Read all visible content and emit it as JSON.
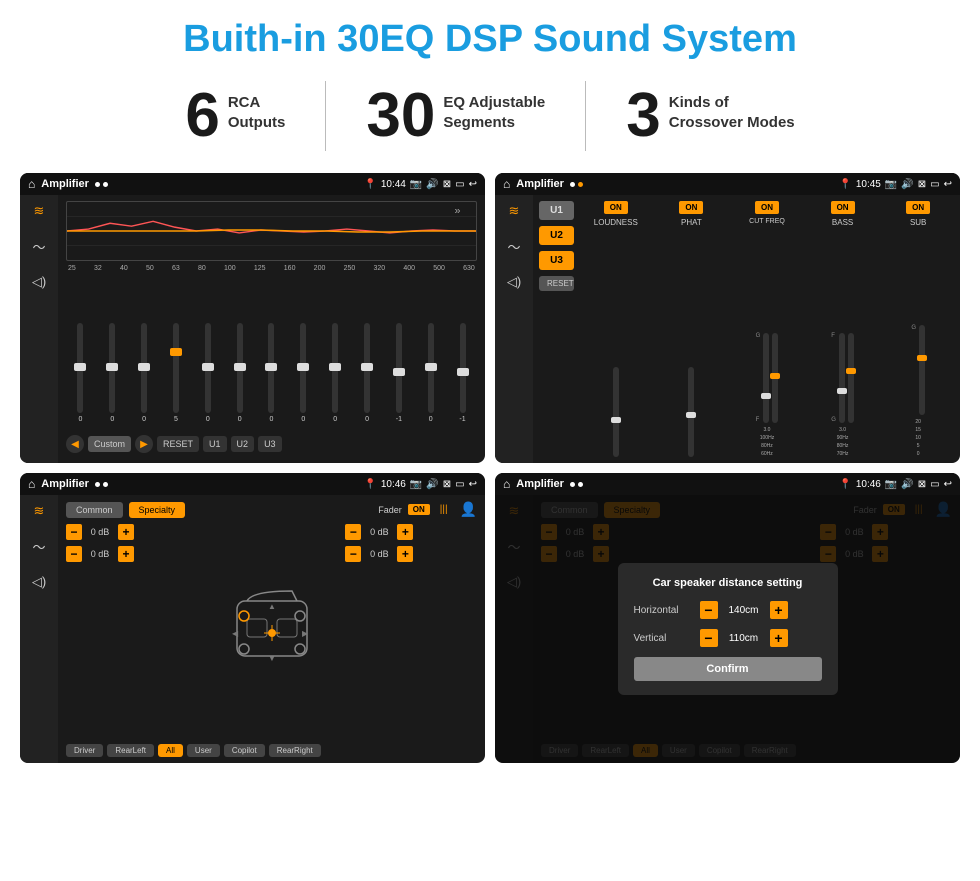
{
  "title": "Buith-in 30EQ DSP Sound System",
  "stats": [
    {
      "number": "6",
      "label": "RCA\nOutputs"
    },
    {
      "number": "30",
      "label": "EQ Adjustable\nSegments"
    },
    {
      "number": "3",
      "label": "Kinds of\nCrossover Modes"
    }
  ],
  "screens": [
    {
      "id": "screen-eq",
      "time": "10:44",
      "app": "Amplifier",
      "dots": [
        "white",
        "white"
      ],
      "freq_labels": [
        "25",
        "32",
        "40",
        "50",
        "63",
        "80",
        "100",
        "125",
        "160",
        "200",
        "250",
        "320",
        "400",
        "500",
        "630"
      ],
      "slider_values": [
        "0",
        "0",
        "0",
        "5",
        "0",
        "0",
        "0",
        "0",
        "0",
        "0",
        "-1",
        "0",
        "-1"
      ],
      "bottom_btns": [
        "Custom",
        "RESET",
        "U1",
        "U2",
        "U3"
      ]
    },
    {
      "id": "screen-amp",
      "time": "10:45",
      "app": "Amplifier",
      "dots": [
        "white",
        "orange"
      ],
      "channels": [
        "LOUDNESS",
        "PHAT",
        "CUT FREQ",
        "BASS",
        "SUB"
      ],
      "u_buttons": [
        "U1",
        "U2",
        "U3"
      ],
      "reset_label": "RESET"
    },
    {
      "id": "screen-fader",
      "time": "10:46",
      "app": "Amplifier",
      "dots": [
        "white",
        "white"
      ],
      "tabs": [
        "Common",
        "Specialty"
      ],
      "fader_label": "Fader",
      "fader_on": "ON",
      "db_rows": [
        {
          "value": "0 dB"
        },
        {
          "value": "0 dB"
        },
        {
          "value": "0 dB"
        },
        {
          "value": "0 dB"
        }
      ],
      "bottom_btns": [
        "Driver",
        "RearLeft",
        "All",
        "User",
        "Copilot",
        "RearRight"
      ]
    },
    {
      "id": "screen-dialog",
      "time": "10:46",
      "app": "Amplifier",
      "dots": [
        "white",
        "white"
      ],
      "tabs": [
        "Common",
        "Specialty"
      ],
      "dialog": {
        "title": "Car speaker distance setting",
        "rows": [
          {
            "label": "Horizontal",
            "value": "140cm"
          },
          {
            "label": "Vertical",
            "value": "110cm"
          }
        ],
        "confirm_label": "Confirm"
      },
      "bottom_btns": [
        "Driver",
        "RearLeft",
        "All",
        "User",
        "Copilot",
        "RearRight"
      ]
    }
  ]
}
